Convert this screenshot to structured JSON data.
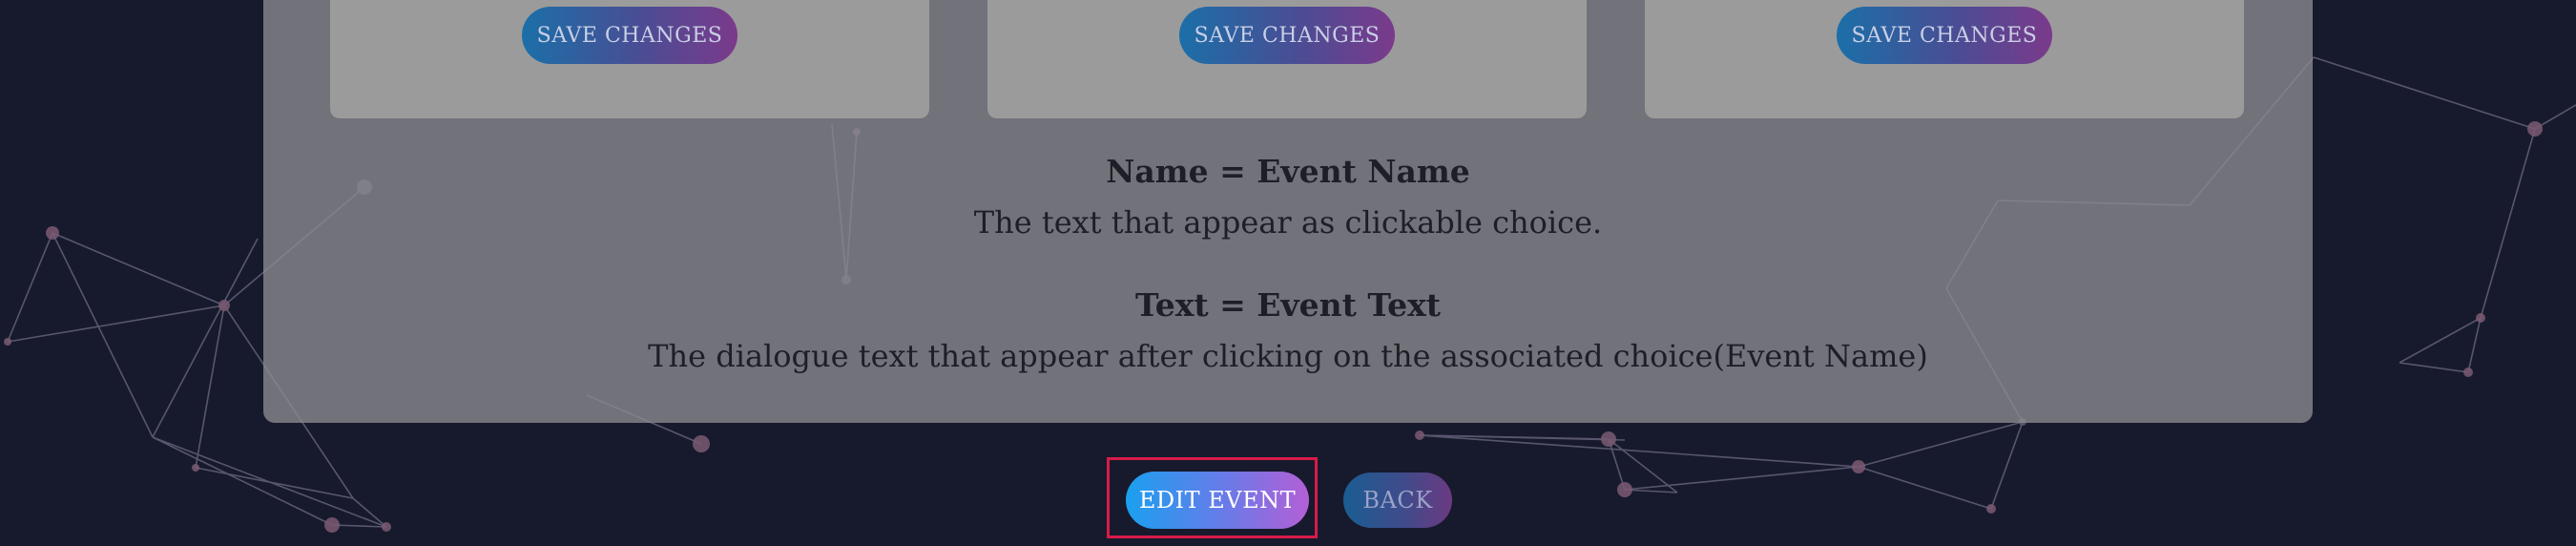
{
  "cards": [
    {
      "save_label": "SAVE CHANGES"
    },
    {
      "save_label": "SAVE CHANGES"
    },
    {
      "save_label": "SAVE CHANGES"
    }
  ],
  "info": {
    "name_title": "Name = Event Name",
    "name_desc": "The text that appear as clickable choice.",
    "text_title": "Text = Event Text",
    "text_desc": "The dialogue text that appear after clicking on the associated choice(Event Name)"
  },
  "actions": {
    "edit_label": "EDIT EVENT",
    "back_label": "BACK"
  },
  "colors": {
    "background": "#171a2c",
    "highlight_border": "#d81b4a",
    "button_gradient_start": "#1aa0ef",
    "button_gradient_end": "#b45fd6"
  }
}
